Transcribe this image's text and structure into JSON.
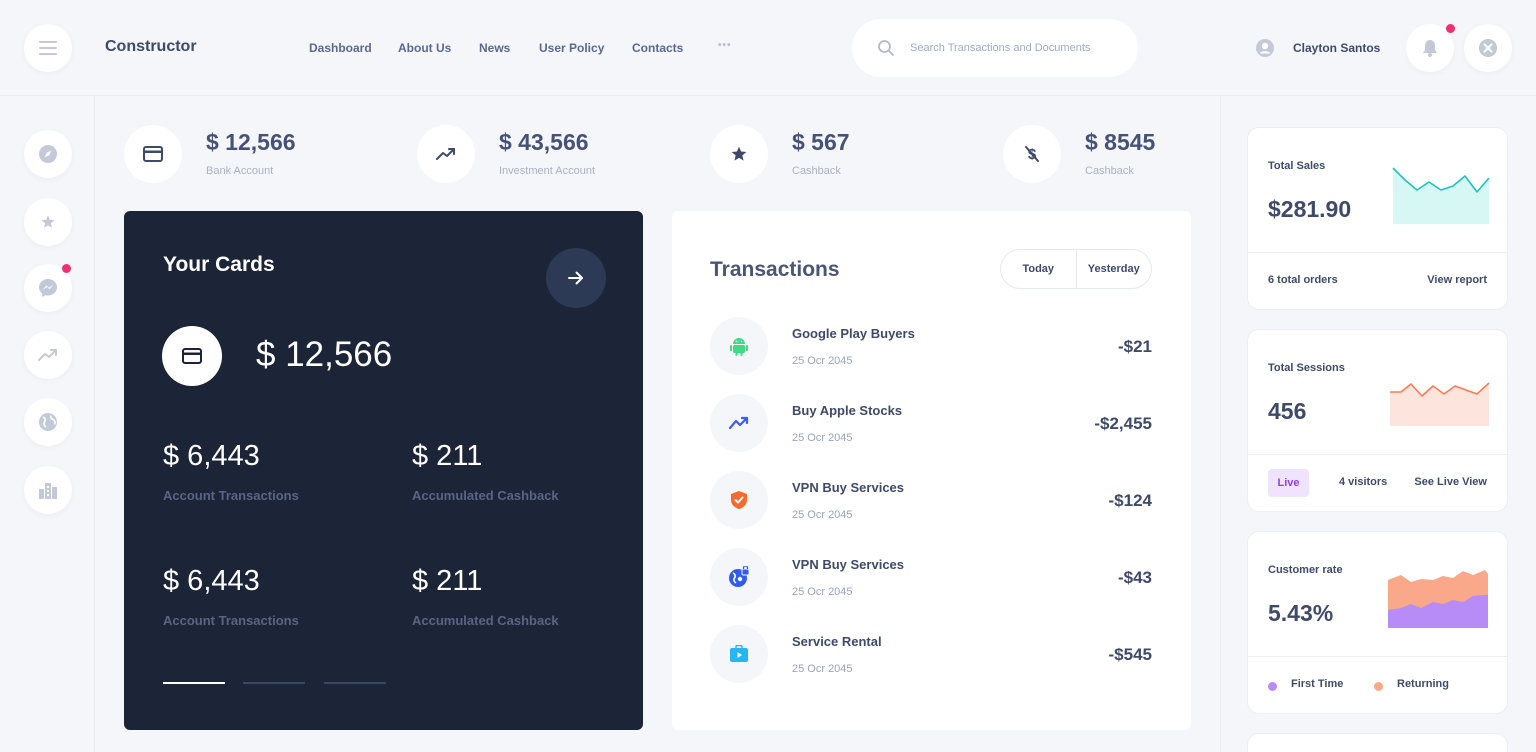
{
  "header": {
    "brand": "Constructor",
    "nav": [
      "Dashboard",
      "About Us",
      "News",
      "User Policy",
      "Contacts"
    ],
    "more_label": "•••",
    "search_placeholder": "Search Transactions and Documents",
    "user_name": "Clayton Santos"
  },
  "sidebar": {
    "items": [
      "compass-icon",
      "star-icon",
      "messenger-icon",
      "trending-icon",
      "globe-icon",
      "building-icon"
    ]
  },
  "stats": [
    {
      "value": "$ 12,566",
      "label": "Bank Account",
      "icon": "card-icon"
    },
    {
      "value": "$ 43,566",
      "label": "Investment Account",
      "icon": "trending-icon"
    },
    {
      "value": "$ 567",
      "label": "Cashback",
      "icon": "star-icon"
    },
    {
      "value": "$ 8545",
      "label": "Cashback",
      "icon": "no-dollar-icon"
    }
  ],
  "cards": {
    "title": "Your Cards",
    "balance": "$ 12,566",
    "items": [
      {
        "value": "$ 6,443",
        "label": "Account Transactions"
      },
      {
        "value": "$ 211",
        "label": "Accumulated Cashback"
      },
      {
        "value": "$ 6,443",
        "label": "Account Transactions"
      },
      {
        "value": "$ 211",
        "label": "Accumulated Cashback"
      }
    ]
  },
  "transactions": {
    "title": "Transactions",
    "tabs": [
      "Today",
      "Yesterday"
    ],
    "rows": [
      {
        "name": "Google Play Buyers",
        "date": "25 Ocr 2045",
        "amount": "-$21",
        "icon": "android-icon"
      },
      {
        "name": "Buy Apple Stocks",
        "date": "25 Ocr 2045",
        "amount": "-$2,455",
        "icon": "trending-icon"
      },
      {
        "name": "VPN Buy Services",
        "date": "25 Ocr 2045",
        "amount": "-$124",
        "icon": "shield-check-icon"
      },
      {
        "name": "VPN Buy Services",
        "date": "25 Ocr 2045",
        "amount": "-$43",
        "icon": "globe-lock-icon"
      },
      {
        "name": "Service Rental",
        "date": "25 Ocr 2045",
        "amount": "-$545",
        "icon": "briefcase-play-icon"
      }
    ]
  },
  "widgets": {
    "sales": {
      "title": "Total Sales",
      "value": "$281.90",
      "orders": "6 total orders",
      "link": "View report",
      "color": "#1bc5bd"
    },
    "sessions": {
      "title": "Total Sessions",
      "value": "456",
      "badge": "Live",
      "visitors": "4 visitors",
      "link": "See Live View",
      "color": "#ff7b52"
    },
    "customer": {
      "title": "Customer rate",
      "value": "5.43%",
      "legend": [
        "First Time",
        "Returning"
      ],
      "colors": [
        "#b88cf6",
        "#f9a98a"
      ]
    }
  }
}
